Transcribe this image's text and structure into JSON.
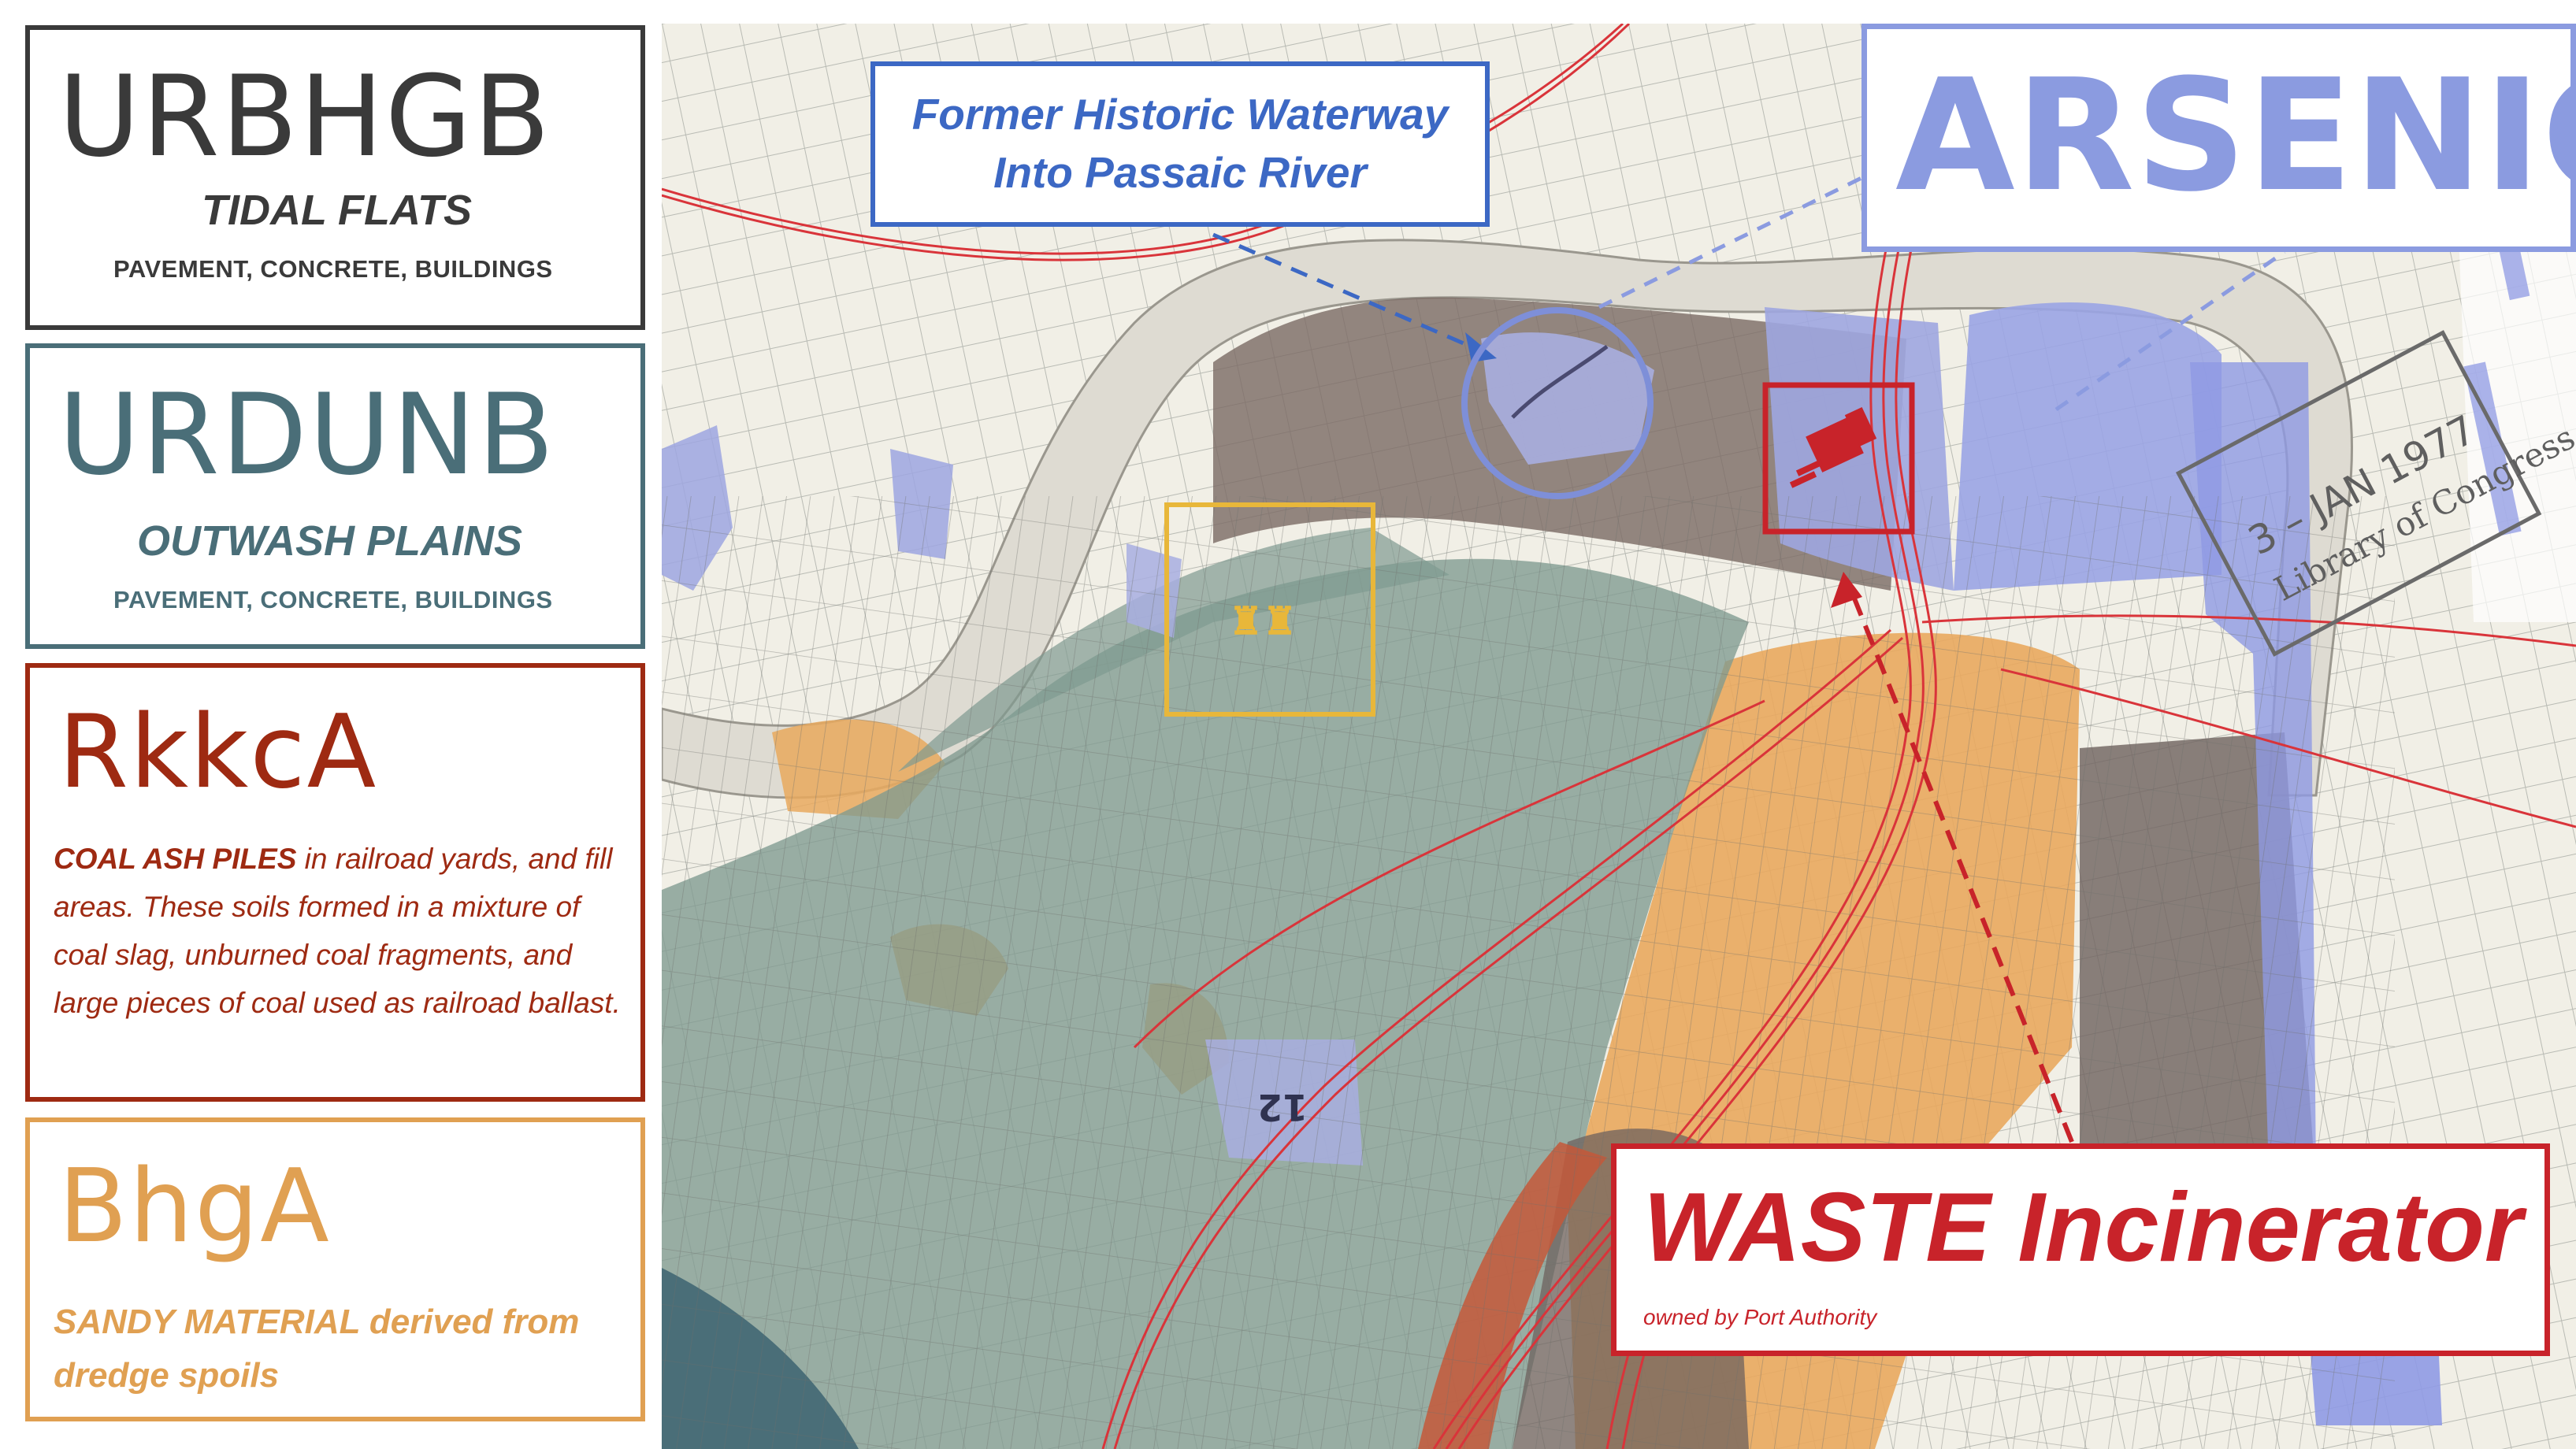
{
  "legend": [
    {
      "code": "URBHGB",
      "subtitle": "TIDAL FLATS",
      "detail": "PAVEMENT, CONCRETE, BUILDINGS"
    },
    {
      "code": "URDUNB",
      "subtitle": "OUTWASH PLAINS",
      "detail": "PAVEMENT, CONCRETE, BUILDINGS"
    },
    {
      "code": "RkkcA",
      "highlight": "COAL ASH PILES",
      "description": "in railroad yards, and fill areas. These soils formed in a mixture of coal slag, unburned coal fragments, and large pieces of coal used as railroad ballast."
    },
    {
      "code": "BhgA",
      "description": "SANDY MATERIAL derived from dredge spoils"
    }
  ],
  "callouts": {
    "waterway": {
      "line1": "Former Historic Waterway",
      "line2": "Into Passaic River"
    },
    "arsenic": "ARSENIC",
    "waste": {
      "title": "WASTE Incinerator",
      "note": "owned by Port Authority"
    }
  },
  "map_labels": {
    "stamp_line1": "3 – JAN 1977",
    "stamp_line2": "Library of Congress",
    "sheet_number": "12"
  },
  "colors": {
    "urbhgb": "#3a3a3a",
    "urdunb": "#4a6e78",
    "rkkca": "#9e2a12",
    "bhga": "#e0a052",
    "waterway": "#3c68c4",
    "arsenic": "#8b9be0",
    "incinerator": "#c8232a"
  }
}
